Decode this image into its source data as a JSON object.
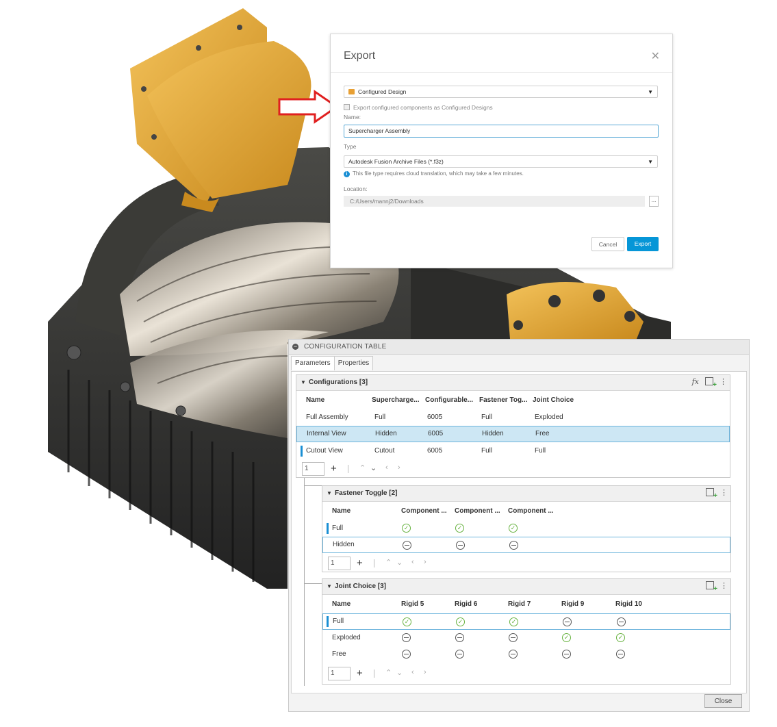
{
  "export_dialog": {
    "title": "Export",
    "close_glyph": "✕",
    "format_select": "Configured Design",
    "checkbox_label": "Export configured components as Configured Designs",
    "name_label": "Name:",
    "name_value": "Supercharger Assembly",
    "type_label": "Type",
    "type_value": "Autodesk Fusion Archive Files (*.f3z)",
    "info_text": "This file type requires cloud translation, which may take a few minutes.",
    "location_label": "Location:",
    "location_value": "C:/Users/mannj2/Downloads",
    "browse_label": "...",
    "cancel_label": "Cancel",
    "export_label": "Export"
  },
  "config_table": {
    "title": "CONFIGURATION TABLE",
    "tabs": [
      "Parameters",
      "Properties"
    ],
    "configurations": {
      "title": "Configurations [3]",
      "columns": [
        "Name",
        "Supercharge...",
        "Configurable...",
        "Fastener Tog...",
        "Joint Choice"
      ],
      "rows": [
        [
          "Full Assembly",
          "Full",
          "6005",
          "Full",
          "Exploded"
        ],
        [
          "Internal View",
          "Hidden",
          "6005",
          "Hidden",
          "Free"
        ],
        [
          "Cutout View",
          "Cutout",
          "6005",
          "Full",
          "Full"
        ]
      ],
      "pager_value": "1"
    },
    "fastener_toggle": {
      "title": "Fastener Toggle [2]",
      "columns": [
        "Name",
        "Component ...",
        "Component ...",
        "Component ..."
      ],
      "rows": [
        {
          "name": "Full",
          "states": [
            "on",
            "on",
            "on"
          ]
        },
        {
          "name": "Hidden",
          "states": [
            "off",
            "off",
            "off"
          ]
        }
      ],
      "pager_value": "1"
    },
    "joint_choice": {
      "title": "Joint Choice [3]",
      "columns": [
        "Name",
        "Rigid 5",
        "Rigid 6",
        "Rigid 7",
        "Rigid 9",
        "Rigid 10"
      ],
      "rows": [
        {
          "name": "Full",
          "states": [
            "on",
            "on",
            "on",
            "off",
            "off"
          ]
        },
        {
          "name": "Exploded",
          "states": [
            "off",
            "off",
            "off",
            "on",
            "on"
          ]
        },
        {
          "name": "Free",
          "states": [
            "off",
            "off",
            "off",
            "off",
            "off"
          ]
        }
      ],
      "pager_value": "1"
    },
    "close_label": "Close"
  },
  "glyphs": {
    "fx": "fx",
    "more": "⋮",
    "plus": "+",
    "up": "⌃",
    "down": "⌄",
    "left": "‹",
    "right": "›",
    "collapse": "▼",
    "caret": "▾",
    "check": "✓",
    "info": "i"
  },
  "colors": {
    "accent_blue": "#0696d7",
    "selection_bg": "#cde7f4",
    "check_green": "#67b23f",
    "callout_red": "#e02020",
    "part_orange": "#e8a034"
  }
}
